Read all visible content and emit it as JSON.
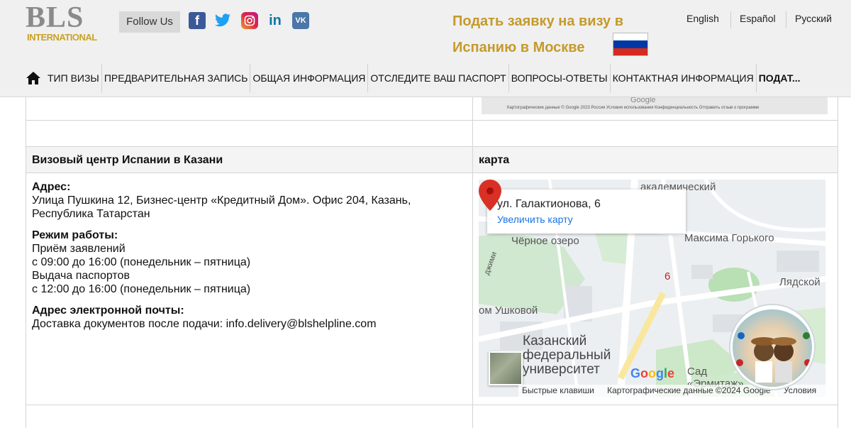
{
  "brand": {
    "logo_main": "BLS",
    "logo_sub": "INTERNATIONAL"
  },
  "header": {
    "follow_label": "Follow Us",
    "social": {
      "facebook": "f",
      "linkedin": "in",
      "vk": "VK"
    },
    "visa_title": "Подать заявку на визу в Испанию в Москве",
    "languages": [
      "English",
      "Español",
      "Русский"
    ]
  },
  "nav": {
    "items": [
      "ТИП ВИЗЫ",
      "ПРЕДВАРИТЕЛЬНАЯ ЗАПИСЬ",
      "ОБЩАЯ ИНФОРМАЦИЯ",
      "ОТСЛЕДИТЕ ВАШ ПАСПОРТ",
      "ВОПРОСЫ-ОТВЕТЫ",
      "КОНТАКТНАЯ ИНФОРМАЦИЯ",
      "ПОДАТ..."
    ]
  },
  "table": {
    "prev_map_attrib": "Картографические данные © Google 2023   Россия   Условия использования   Конфиденциальность   Отправить отзыв о программе",
    "center_title": "Визовый центр Испании в Казани",
    "map_title": "карта",
    "address_label": "Адрес:",
    "address_value": "Улица Пушкина 12, Бизнес-центр «Кредитный Дом». Офис 204, Казань, Республика Татарстан",
    "hours_label": "Режим работы:",
    "hours_line1": "Приём заявлений",
    "hours_line2": "с 09:00 до 16:00 (понедельник – пятница)",
    "hours_line3": "Выдача паспортов",
    "hours_line4": "с 12:00 до 16:00 (понедельник – пятница)",
    "email_label": "Адрес электронной почты:",
    "email_value": "Доставка документов после подачи: info.delivery@blshelpline.com"
  },
  "map": {
    "place_title": "ул. Галактионова, 6",
    "enlarge_link": "Увеличить карту",
    "pin_number": "6",
    "labels": {
      "academic": "академический",
      "gorky": "Максима Горького",
      "chernoe": "Чёрное озеро",
      "ushkovoy": "ом Ушковой",
      "lyadskoy": "Лядской",
      "university": "Казанский федеральный университет",
      "hermitage": "Сад «Эрмитаж»",
      "dzhima": "джими"
    },
    "google_letters": [
      "G",
      "o",
      "o",
      "g",
      "l",
      "e"
    ],
    "footer_shortcuts": "Быстрые клавиши",
    "footer_data": "Картографические данные ©2024 Google",
    "footer_terms": "Условия"
  },
  "colors": {
    "gold": "#c59a2a",
    "link": "#1a73e8",
    "pin": "#d93025"
  }
}
